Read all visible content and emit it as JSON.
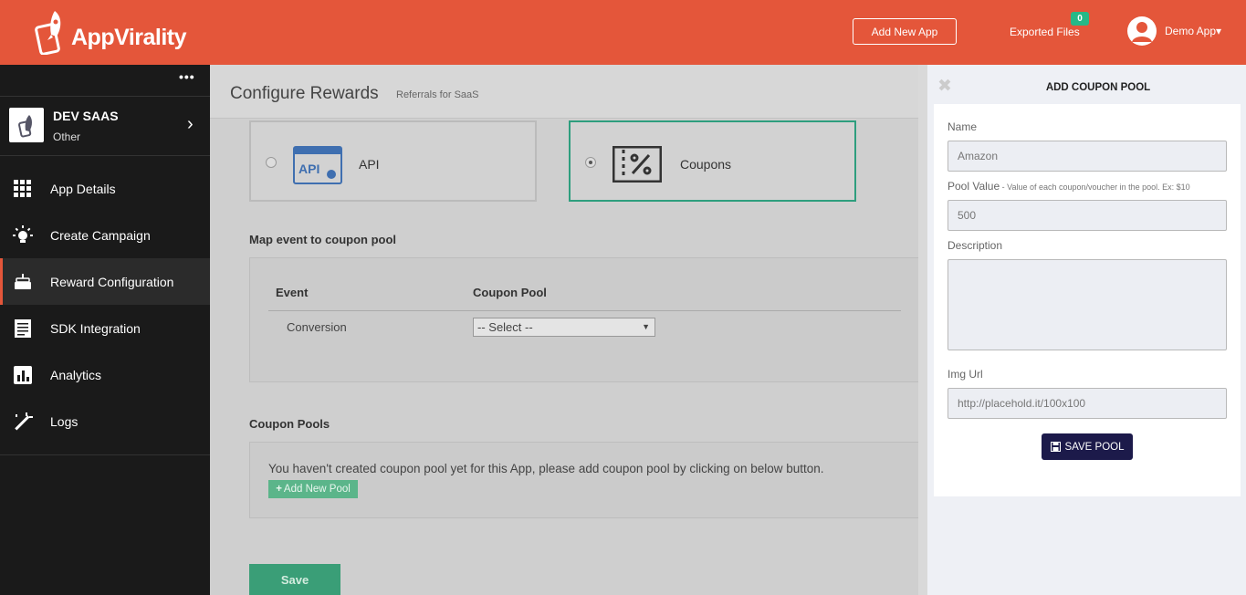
{
  "colors": {
    "brand": "#e4563a",
    "sidebar": "#1a1a1a",
    "accent_green": "#2e9e7e",
    "save_pool": "#1c1a4a",
    "badge": "#27b887"
  },
  "header": {
    "logo_text": "AppVirality",
    "add_app_label": "Add New App",
    "exported_label": "Exported Files",
    "exported_count": "0",
    "user_label": "Demo App▾"
  },
  "sidebar": {
    "more_icon": "ellipsis-icon",
    "app": {
      "name": "DEV SAAS",
      "type": "Other",
      "chevron": "›"
    },
    "items": [
      {
        "label": "App Details",
        "icon": "grid-icon",
        "active": false
      },
      {
        "label": "Create Campaign",
        "icon": "bulb-icon",
        "active": false
      },
      {
        "label": "Reward Configuration",
        "icon": "cake-icon",
        "active": true
      },
      {
        "label": "SDK Integration",
        "icon": "document-icon",
        "active": false
      },
      {
        "label": "Analytics",
        "icon": "bar-chart-icon",
        "active": false
      },
      {
        "label": "Logs",
        "icon": "magic-wand-icon",
        "active": false
      }
    ]
  },
  "main": {
    "title": "Configure Rewards",
    "subtitle": "Referrals for SaaS",
    "reward_types": [
      {
        "label": "API",
        "selected": false
      },
      {
        "label": "Coupons",
        "selected": true
      }
    ],
    "map_section_title": "Map event to coupon pool",
    "table": {
      "headers": [
        "Event",
        "Coupon Pool"
      ],
      "rows": [
        {
          "event": "Conversion",
          "pool": "-- Select --"
        }
      ]
    },
    "pools_title": "Coupon Pools",
    "empty_message": "You haven't created coupon pool yet for this App, please add coupon pool by clicking on below button.",
    "add_pool_label": "Add New Pool",
    "save_label": "Save"
  },
  "panel": {
    "close": "✖",
    "title": "ADD COUPON POOL",
    "name_label": "Name",
    "name_placeholder": "Amazon",
    "value_label": "Pool Value",
    "value_hint": " - Value of each coupon/voucher in the pool. Ex: $10",
    "value_placeholder": "500",
    "desc_label": "Description",
    "img_label": "Img Url",
    "img_placeholder": "http://placehold.it/100x100",
    "save_label": "SAVE POOL"
  }
}
